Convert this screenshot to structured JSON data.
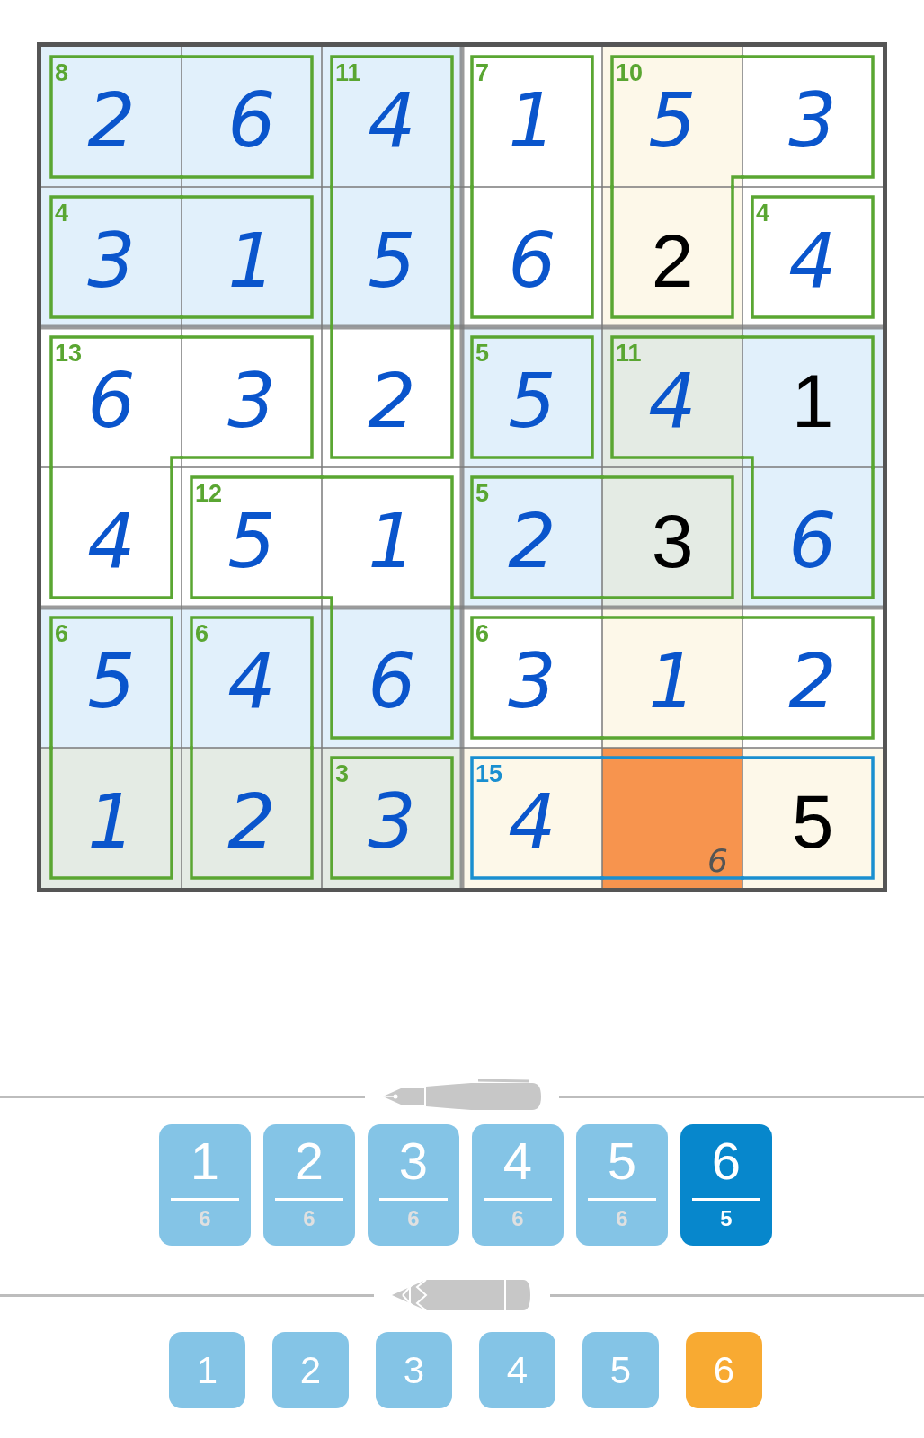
{
  "grid": {
    "rows": [
      {
        "cells": [
          {
            "value": "2",
            "kind": "entered",
            "selected": false,
            "cage": {
              "sum": "8",
              "selected": false,
              "top": true,
              "right": false,
              "bottom": true,
              "left": true
            }
          },
          {
            "value": "6",
            "kind": "entered",
            "selected": false,
            "cage": {
              "selected": false,
              "top": true,
              "right": true,
              "bottom": true,
              "left": false
            }
          },
          {
            "value": "4",
            "kind": "entered",
            "selected": false,
            "cage": {
              "sum": "11",
              "selected": false,
              "top": true,
              "right": true,
              "bottom": false,
              "left": true
            }
          },
          {
            "value": "1",
            "kind": "entered",
            "selected": false,
            "cage": {
              "sum": "7",
              "selected": false,
              "top": true,
              "right": true,
              "bottom": false,
              "left": true
            }
          },
          {
            "value": "5",
            "kind": "entered",
            "selected": false,
            "cage": {
              "sum": "10",
              "selected": false,
              "top": true,
              "right": false,
              "bottom": false,
              "left": true
            }
          },
          {
            "value": "3",
            "kind": "entered",
            "selected": false,
            "cage": {
              "selected": false,
              "top": true,
              "right": true,
              "bottom": true,
              "left": false
            }
          }
        ]
      },
      {
        "cells": [
          {
            "value": "3",
            "kind": "entered",
            "selected": false,
            "cage": {
              "sum": "4",
              "selected": false,
              "top": true,
              "right": false,
              "bottom": true,
              "left": true
            }
          },
          {
            "value": "1",
            "kind": "entered",
            "selected": false,
            "cage": {
              "selected": false,
              "top": true,
              "right": true,
              "bottom": true,
              "left": false
            }
          },
          {
            "value": "5",
            "kind": "entered",
            "selected": false,
            "cage": {
              "selected": false,
              "top": false,
              "right": true,
              "bottom": false,
              "left": true
            }
          },
          {
            "value": "6",
            "kind": "entered",
            "selected": false,
            "cage": {
              "selected": false,
              "top": false,
              "right": true,
              "bottom": true,
              "left": true
            }
          },
          {
            "value": "2",
            "kind": "given",
            "selected": false,
            "cage": {
              "selected": false,
              "top": false,
              "right": true,
              "bottom": true,
              "left": true
            }
          },
          {
            "value": "4",
            "kind": "entered",
            "selected": false,
            "cage": {
              "sum": "4",
              "selected": false,
              "top": true,
              "right": true,
              "bottom": true,
              "left": true
            }
          }
        ]
      },
      {
        "cells": [
          {
            "value": "6",
            "kind": "entered",
            "selected": false,
            "cage": {
              "sum": "13",
              "selected": false,
              "top": true,
              "right": false,
              "bottom": false,
              "left": true
            }
          },
          {
            "value": "3",
            "kind": "entered",
            "selected": false,
            "cage": {
              "selected": false,
              "top": true,
              "right": true,
              "bottom": true,
              "left": false
            }
          },
          {
            "value": "2",
            "kind": "entered",
            "selected": false,
            "cage": {
              "selected": false,
              "top": false,
              "right": true,
              "bottom": true,
              "left": true
            }
          },
          {
            "value": "5",
            "kind": "entered",
            "selected": false,
            "cage": {
              "sum": "5",
              "selected": false,
              "top": true,
              "right": true,
              "bottom": true,
              "left": true
            }
          },
          {
            "value": "4",
            "kind": "entered",
            "selected": false,
            "cage": {
              "sum": "11",
              "selected": false,
              "top": true,
              "right": false,
              "bottom": true,
              "left": true
            }
          },
          {
            "value": "1",
            "kind": "given",
            "selected": false,
            "cage": {
              "selected": false,
              "top": true,
              "right": true,
              "bottom": false,
              "left": false
            }
          }
        ]
      },
      {
        "cells": [
          {
            "value": "4",
            "kind": "entered",
            "selected": false,
            "cage": {
              "selected": false,
              "top": false,
              "right": true,
              "bottom": true,
              "left": true
            }
          },
          {
            "value": "5",
            "kind": "entered",
            "selected": false,
            "cage": {
              "sum": "12",
              "selected": false,
              "top": true,
              "right": false,
              "bottom": true,
              "left": true
            }
          },
          {
            "value": "1",
            "kind": "entered",
            "selected": false,
            "cage": {
              "selected": false,
              "top": true,
              "right": true,
              "bottom": false,
              "left": false
            }
          },
          {
            "value": "2",
            "kind": "entered",
            "selected": false,
            "cage": {
              "sum": "5",
              "selected": false,
              "top": true,
              "right": false,
              "bottom": true,
              "left": true
            }
          },
          {
            "value": "3",
            "kind": "given",
            "selected": false,
            "cage": {
              "selected": false,
              "top": true,
              "right": true,
              "bottom": true,
              "left": false
            }
          },
          {
            "value": "6",
            "kind": "entered",
            "selected": false,
            "cage": {
              "selected": false,
              "top": false,
              "right": true,
              "bottom": true,
              "left": true
            }
          }
        ]
      },
      {
        "cells": [
          {
            "value": "5",
            "kind": "entered",
            "selected": false,
            "cage": {
              "sum": "6",
              "selected": false,
              "top": true,
              "right": true,
              "bottom": false,
              "left": true
            }
          },
          {
            "value": "4",
            "kind": "entered",
            "selected": false,
            "cage": {
              "sum": "6",
              "selected": false,
              "top": true,
              "right": true,
              "bottom": false,
              "left": true
            }
          },
          {
            "value": "6",
            "kind": "entered",
            "selected": false,
            "cage": {
              "selected": false,
              "top": false,
              "right": true,
              "bottom": true,
              "left": true
            }
          },
          {
            "value": "3",
            "kind": "entered",
            "selected": false,
            "cage": {
              "sum": "6",
              "selected": false,
              "top": true,
              "right": false,
              "bottom": true,
              "left": true
            }
          },
          {
            "value": "1",
            "kind": "entered",
            "selected": false,
            "cage": {
              "selected": false,
              "top": true,
              "right": false,
              "bottom": true,
              "left": false
            }
          },
          {
            "value": "2",
            "kind": "entered",
            "selected": false,
            "cage": {
              "selected": false,
              "top": true,
              "right": true,
              "bottom": true,
              "left": false
            }
          }
        ]
      },
      {
        "cells": [
          {
            "value": "1",
            "kind": "entered",
            "selected": false,
            "cage": {
              "selected": false,
              "top": false,
              "right": true,
              "bottom": true,
              "left": true
            }
          },
          {
            "value": "2",
            "kind": "entered",
            "selected": false,
            "cage": {
              "selected": false,
              "top": false,
              "right": true,
              "bottom": true,
              "left": true
            }
          },
          {
            "value": "3",
            "kind": "entered",
            "selected": false,
            "cage": {
              "sum": "3",
              "selected": false,
              "top": true,
              "right": true,
              "bottom": true,
              "left": true
            }
          },
          {
            "value": "4",
            "kind": "entered",
            "selected": false,
            "cage": {
              "sum": "15",
              "selected": true,
              "top": true,
              "right": false,
              "bottom": true,
              "left": true
            }
          },
          {
            "kind": "empty",
            "selected": true,
            "pencil_marks": [
              "6"
            ],
            "cage": {
              "selected": true,
              "top": true,
              "right": false,
              "bottom": true,
              "left": false
            }
          },
          {
            "value": "5",
            "kind": "given",
            "selected": false,
            "cage": {
              "selected": true,
              "top": true,
              "right": true,
              "bottom": true,
              "left": false
            }
          }
        ]
      }
    ]
  },
  "pen_buttons": [
    {
      "digit": "1",
      "count": "6",
      "selected": false
    },
    {
      "digit": "2",
      "count": "6",
      "selected": false
    },
    {
      "digit": "3",
      "count": "6",
      "selected": false
    },
    {
      "digit": "4",
      "count": "6",
      "selected": false
    },
    {
      "digit": "5",
      "count": "6",
      "selected": false
    },
    {
      "digit": "6",
      "count": "5",
      "selected": true
    }
  ],
  "pencil_buttons": [
    {
      "digit": "1",
      "selected": false
    },
    {
      "digit": "2",
      "selected": false
    },
    {
      "digit": "3",
      "selected": false
    },
    {
      "digit": "4",
      "selected": false
    },
    {
      "digit": "5",
      "selected": false
    },
    {
      "digit": "6",
      "selected": true
    }
  ]
}
